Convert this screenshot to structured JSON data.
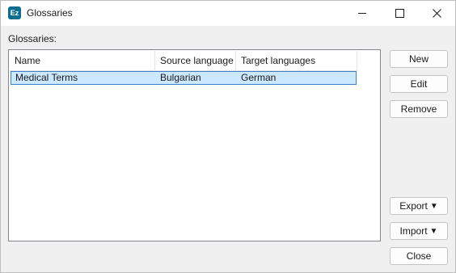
{
  "window": {
    "title": "Glossaries",
    "app_icon_text": "Ez"
  },
  "glossaries": {
    "label": "Glossaries:",
    "columns": [
      "Name",
      "Source language",
      "Target languages"
    ],
    "rows": [
      {
        "name": "Medical Terms",
        "source": "Bulgarian",
        "target": "German",
        "selected": true
      }
    ]
  },
  "buttons": {
    "new": "New",
    "edit": "Edit",
    "remove": "Remove",
    "export": "Export",
    "import": "Import",
    "close": "Close",
    "dropdown_glyph": "▼"
  },
  "colors": {
    "selection_fill": "#cce8ff",
    "selection_border": "#3d7fc6",
    "app_icon": "#0b6e8f"
  }
}
